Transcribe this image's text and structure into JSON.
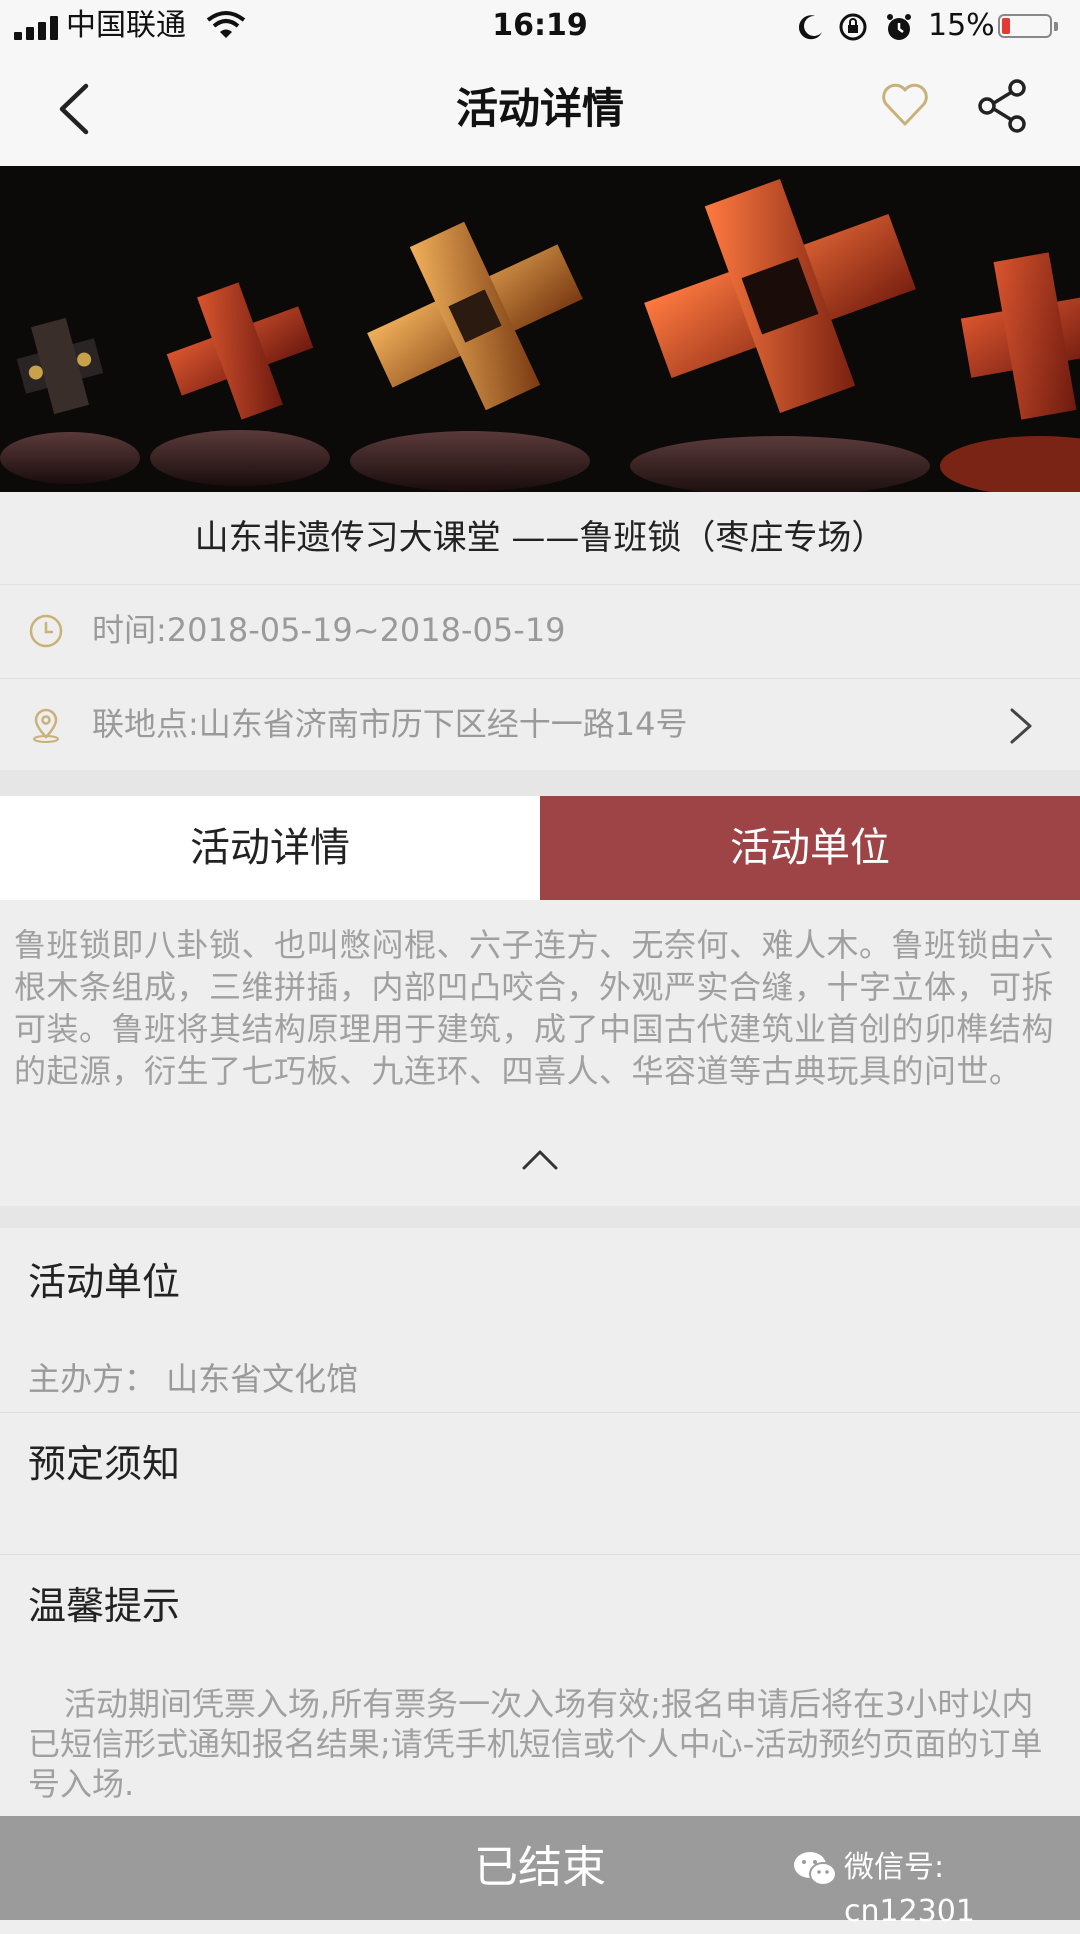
{
  "status_bar": {
    "carrier": "中国联通",
    "time": "16:19",
    "battery": "15%"
  },
  "nav": {
    "title": "活动详情"
  },
  "event": {
    "title": "山东非遗传习大课堂 ——鲁班锁（枣庄专场）",
    "time": "时间:2018-05-19~2018-05-19",
    "location": "联地点:山东省济南市历下区经十一路14号"
  },
  "tabs": [
    {
      "label": "活动详情"
    },
    {
      "label": "活动单位"
    }
  ],
  "description": "鲁班锁即八卦锁、也叫憋闷棍、六子连方、无奈何、难人木。鲁班锁由六根木条组成，三维拼插，内部凹凸咬合，外观严实合缝，十字立体，可拆可装。鲁班将其结构原理用于建筑，成了中国古代建筑业首创的卯榫结构的起源，衍生了七巧板、九连环、四喜人、华容道等古典玩具的问世。",
  "sections": {
    "units_title": "活动单位",
    "organizer": "主办方：  山东省文化馆",
    "booking_title": "预定须知",
    "tips_title": "温馨提示",
    "tips_text": "活动期间凭票入场,所有票务一次入场有效;报名申请后将在3小时以内已短信形式通知报名结果;请凭手机短信或个人中心-活动预约页面的订单号入场."
  },
  "bottom": {
    "status_label": "已结束",
    "watermark": "微信号: cn12301"
  },
  "colors": {
    "accent": "#9e4446",
    "bottom_bar": "#9b9b9b",
    "icon_gold": "#c9b27a"
  }
}
